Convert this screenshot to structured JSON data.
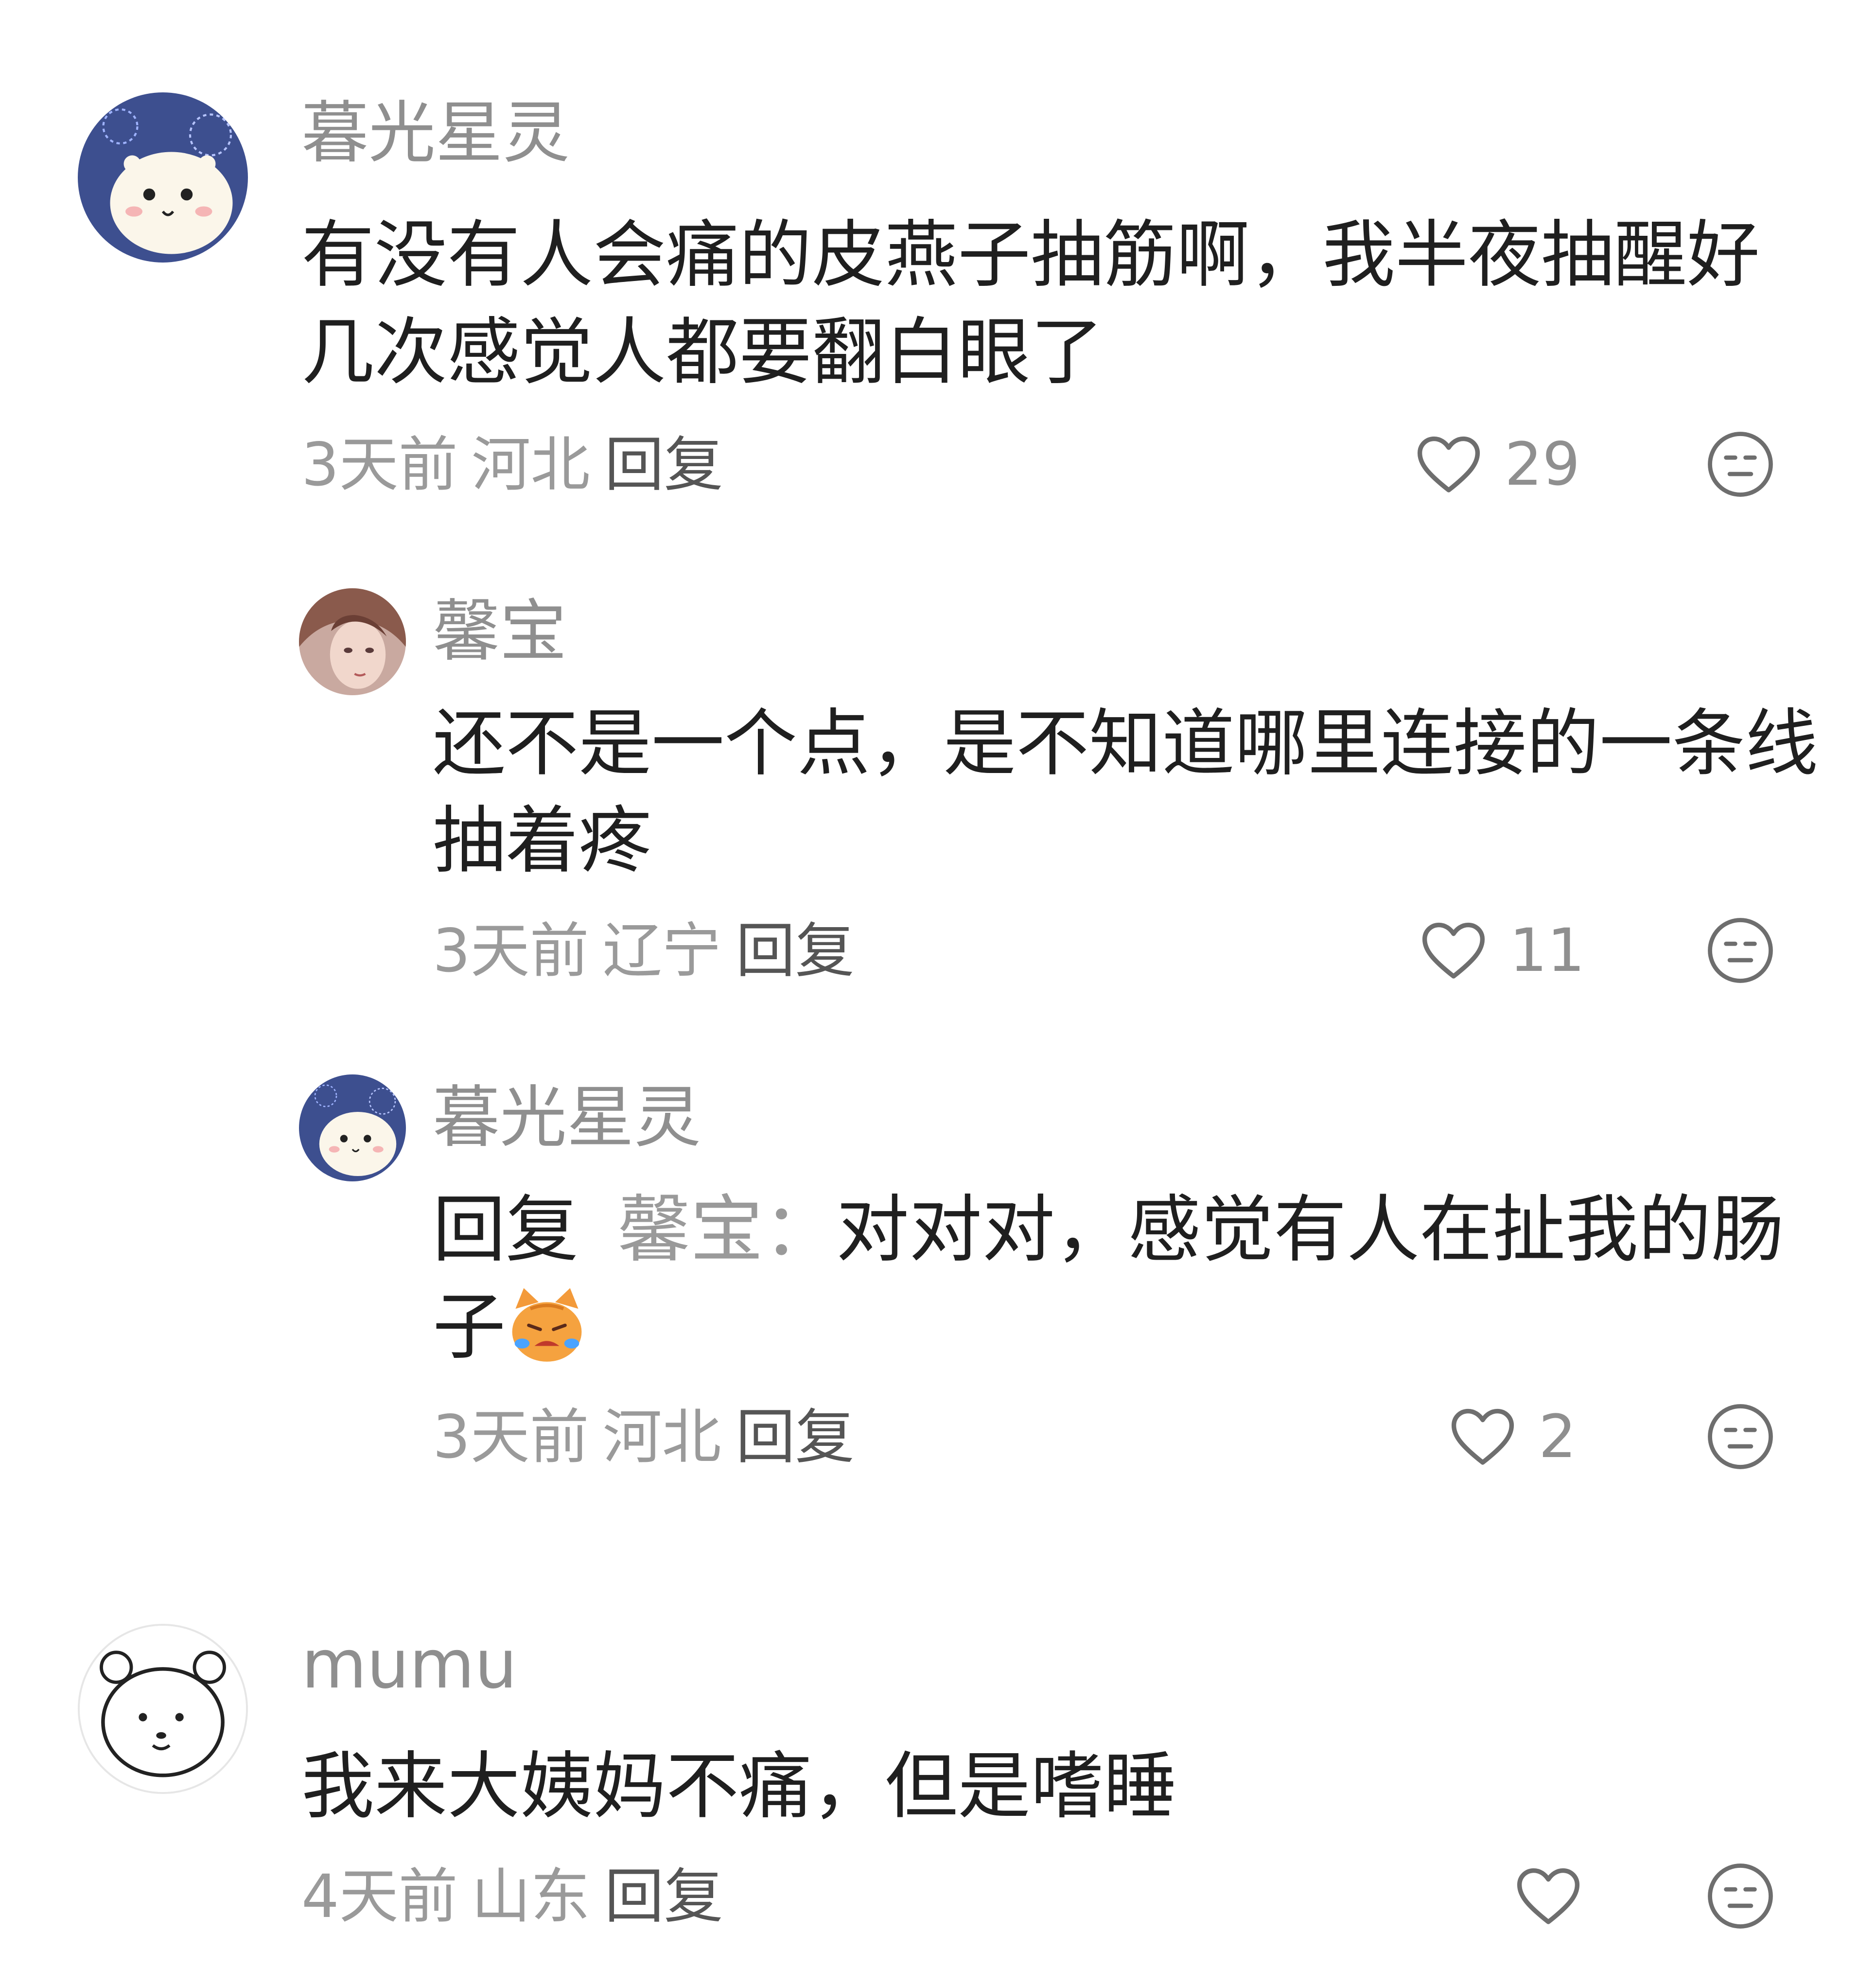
{
  "comments": [
    {
      "username": "暮光星灵",
      "text": "有没有人会痛的皮燕子抽筋啊，我半夜抽醒好几次感觉人都要翻白眼了",
      "time": "3天前",
      "location": "河北",
      "reply_label": "回复",
      "likes": "29",
      "avatar": "hamster-fireworks-avatar"
    },
    {
      "username": "馨宝",
      "text": "还不是一个点，是不知道哪里连接的一条线抽着疼",
      "time": "3天前",
      "location": "辽宁",
      "reply_label": "回复",
      "likes": "11",
      "avatar": "anime-girl-avatar"
    },
    {
      "username": "暮光星灵",
      "reply_prefix": "回复",
      "mention": "馨宝",
      "mention_colon": "：",
      "text": "对对对，感觉有人在扯我的肠子",
      "emoji": "crying-cat-emoji",
      "time": "3天前",
      "location": "河北",
      "reply_label": "回复",
      "likes": "2",
      "avatar": "hamster-fireworks-avatar"
    },
    {
      "username": "mumu",
      "text": "我来大姨妈不痛，但是嗜睡",
      "time": "4天前",
      "location": "山东",
      "reply_label": "回复",
      "likes": "",
      "avatar": "white-bear-avatar"
    }
  ],
  "colors": {
    "username": "#8f8f8f",
    "text": "#1f1f1f",
    "meta": "#9a9a9a",
    "icon": "#6e6e6e"
  }
}
